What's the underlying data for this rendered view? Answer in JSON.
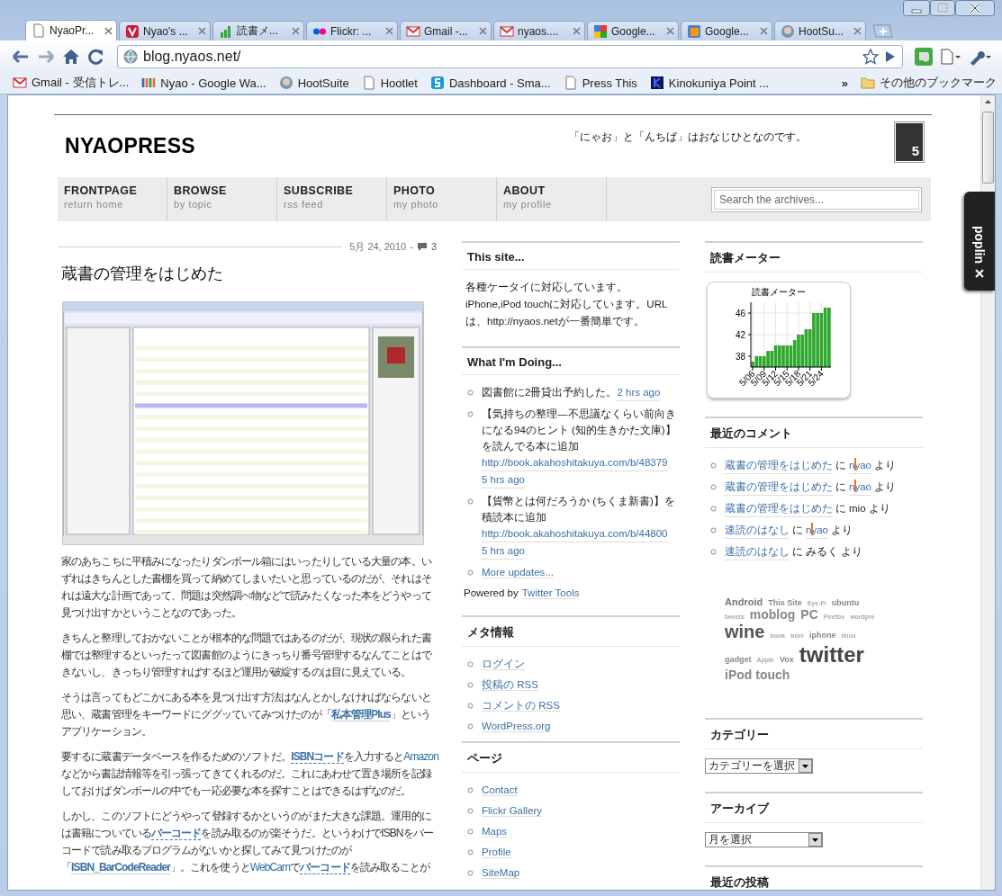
{
  "browser": {
    "tabs": [
      {
        "title": "NyaoPr...",
        "selected": true
      },
      {
        "title": "Nyao's ...",
        "selected": false
      },
      {
        "title": "読書メ...",
        "selected": false
      },
      {
        "title": "Flickr: ...",
        "selected": false
      },
      {
        "title": "Gmail -...",
        "selected": false
      },
      {
        "title": "nyaos....",
        "selected": false
      },
      {
        "title": "Google...",
        "selected": false
      },
      {
        "title": "Google...",
        "selected": false
      },
      {
        "title": "HootSu...",
        "selected": false
      }
    ],
    "address": "blog.nyaos.net/",
    "bookmarks": [
      "Gmail - 受信トレ...",
      "Nyao - Google Wa...",
      "HootSuite",
      "Hootlet",
      "Dashboard - Sma...",
      "Press This",
      "Kinokuniya Point ..."
    ],
    "bookmarks_more": "»",
    "other_bookmarks": "その他のブックマーク"
  },
  "site": {
    "title": "NYAOPRESS",
    "tagline": "「にゃお」と「んちば」はおなじひとなのです。",
    "comment_count": "5",
    "nav": [
      {
        "label": "FRONTPAGE",
        "sub": "return home"
      },
      {
        "label": "BROWSE",
        "sub": "by topic"
      },
      {
        "label": "SUBSCRIBE",
        "sub": "rss feed"
      },
      {
        "label": "PHOTO",
        "sub": "my photo"
      },
      {
        "label": "ABOUT",
        "sub": "my profile"
      }
    ],
    "search": {
      "placeholder": "Search the archives..."
    }
  },
  "post": {
    "date": "5月 24, 2010",
    "separator": "-",
    "comments": "3",
    "title": "蔵書の管理をはじめた",
    "image": {
      "kind": "picture"
    },
    "paragraphs": [
      [
        {
          "kind": "text",
          "text": "家のあちこちに平積みになったりダンボール箱にはいったりしている大量の本。いずれはきちんとした書棚を買って納めてしまいたいと思っているのだが、それはそれは遠大な計画であって、問題は突然調べ物などで読みたくなった本をどうやって見つけ出すかということなのであった。"
        }
      ],
      [
        {
          "kind": "text",
          "text": "きちんと整理しておかないことが根本的な問題ではあるのだが、現状の限られた書棚では整理するといったって図書館のようにきっちり番号管理するなんてことはできないし、きっちり管理すればするほど運用が破綻するのは目に見えている。"
        }
      ],
      [
        {
          "kind": "text",
          "text": "そうは言ってもどこかにある本を見つけ出す方法はなんとかしなければならないと思い、蔵書管理をキーワードにググッていてみつけたのが「"
        },
        {
          "kind": "link",
          "text": "私本管理Plus"
        },
        {
          "kind": "text",
          "text": "」というアプリケーション。"
        }
      ],
      [
        {
          "kind": "text",
          "text": "要するに蔵書データベースを作るためのソフトだ。"
        },
        {
          "kind": "keyword",
          "text": "ISBNコード"
        },
        {
          "kind": "text",
          "text": "を入力すると"
        },
        {
          "kind": "term",
          "text": "Amazon"
        },
        {
          "kind": "text",
          "text": "などから書誌情報等を引っ張ってきてくれるのだ。これにあわせて置き場所を記録しておけばダンボールの中でも一応必要な本を探すことはできるはずなのだ。"
        }
      ],
      [
        {
          "kind": "text",
          "text": "しかし、このソフトにどうやって登録するかというのがまた大きな課題。運用的には書籍についている"
        },
        {
          "kind": "keyword",
          "text": "バーコード"
        },
        {
          "kind": "text",
          "text": "を読み取るのが楽そうだ。というわけでISBNをバーコードで読み取るプログラムがないかと探してみて見つけたのが「"
        },
        {
          "kind": "link",
          "text": "ISBN_BarCodeReader"
        },
        {
          "kind": "text",
          "text": "」。これを使うと"
        },
        {
          "kind": "term",
          "text": "WebCam"
        },
        {
          "kind": "text",
          "text": "で"
        },
        {
          "kind": "keyword",
          "text": "バーコード"
        },
        {
          "kind": "text",
          "text": "を読み取ることが"
        }
      ]
    ]
  },
  "sidebar": {
    "this_site": {
      "title": "This site...",
      "text": "各種ケータイに対応しています。iPhone,iPod touchに対応しています。URLは、http://nyaos.netが一番簡単です。"
    },
    "doing": {
      "title": "What I'm Doing...",
      "items": [
        {
          "text": "図書館に2冊貸出予約した。",
          "time": "2 hrs ago"
        },
        {
          "text": "【気持ちの整理―不思議なくらい前向きになる94のヒント (知的生きかた文庫)】を読んでる本に追加",
          "links": [
            "http://book.akahoshitakuya.com/b/48379"
          ],
          "time": "5 hrs ago"
        },
        {
          "text": "【貨幣とは何だろうか (ちくま新書)】を積読本に追加",
          "links": [
            "http://book.akahoshitakuya.com/b/44800"
          ],
          "time": "5 hrs ago"
        }
      ],
      "more": "More updates...",
      "powered": "Powered by",
      "powered_link": "Twitter Tools"
    },
    "meta": {
      "title": "メタ情報",
      "links": [
        "ログイン",
        "投稿の RSS",
        "コメントの RSS",
        "WordPress.org"
      ]
    },
    "pages": {
      "title": "ページ",
      "links": [
        "Contact",
        "Flickr Gallery",
        "Maps",
        "Profile",
        "SiteMap"
      ]
    }
  },
  "right": {
    "meter": {
      "title": "読書メーター",
      "chart_data": {
        "type": "bar",
        "title": "読書メーター",
        "categories": [
          "5/06",
          null,
          null,
          "5/09",
          null,
          null,
          "5/12",
          null,
          null,
          "5/15",
          null,
          null,
          "5/18",
          null,
          null,
          "5/21",
          null,
          null,
          "5/24",
          null,
          null
        ],
        "series": [
          {
            "color": "#2ea82e",
            "values": [
              37,
              38,
              38,
              38,
              39,
              39,
              40,
              40,
              40,
              40,
              40,
              41,
              42,
              42,
              43,
              43,
              46,
              46,
              46,
              47,
              47
            ]
          }
        ],
        "ylim": [
          36,
          48
        ],
        "yticks": [
          38,
          42,
          46
        ],
        "grid": true
      }
    },
    "comments": {
      "title": "最近のコメント",
      "items": [
        {
          "post": "蔵書の管理をはじめた",
          "on": "に",
          "author": "nyao",
          "author_link": true,
          "marked": true,
          "by": "より"
        },
        {
          "post": "蔵書の管理をはじめた",
          "on": "に",
          "author": "nyao",
          "author_link": true,
          "marked": true,
          "by": "より"
        },
        {
          "post": "蔵書の管理をはじめた",
          "on": "に",
          "author": "mio",
          "author_link": false,
          "marked": false,
          "by": "より"
        },
        {
          "post": "速読のはなし",
          "on": "に",
          "author": "nyao",
          "author_link": true,
          "marked": true,
          "by": "より"
        },
        {
          "post": "速読のはなし",
          "on": "に",
          "author": "みるく",
          "author_link": false,
          "marked": false,
          "by": "より"
        }
      ]
    },
    "tags": [
      {
        "text": "Android",
        "kind": "m"
      },
      {
        "text": "This Site",
        "kind": "s"
      },
      {
        "text": "Eye-Fi",
        "kind": "xs"
      },
      {
        "text": "ubuntu",
        "kind": "s"
      },
      {
        "text": "tweets",
        "kind": "xs"
      },
      {
        "text": "moblog",
        "kind": "l"
      },
      {
        "text": "PC",
        "kind": "l"
      },
      {
        "text": "Firefox",
        "kind": "xs"
      },
      {
        "text": "wordpre",
        "kind": "xs"
      },
      {
        "text": "wine",
        "kind": "xl"
      },
      {
        "text": "book",
        "kind": "xs"
      },
      {
        "text": "beer",
        "kind": "xs"
      },
      {
        "text": "iphone",
        "kind": "s"
      },
      {
        "text": "linux",
        "kind": "xs"
      },
      {
        "text": "gadget",
        "kind": "s"
      },
      {
        "text": "Apple",
        "kind": "xs"
      },
      {
        "text": "Vox",
        "kind": "s"
      },
      {
        "text": "twitter",
        "kind": "xxl"
      },
      {
        "text": "iPod touch",
        "kind": "l"
      }
    ],
    "category": {
      "title": "カテゴリー",
      "select": "カテゴリーを選択"
    },
    "archive": {
      "title": "アーカイブ",
      "select": "月を選択"
    },
    "recent": {
      "title": "最近の投稿"
    }
  },
  "popin": {
    "label": "poplin"
  }
}
